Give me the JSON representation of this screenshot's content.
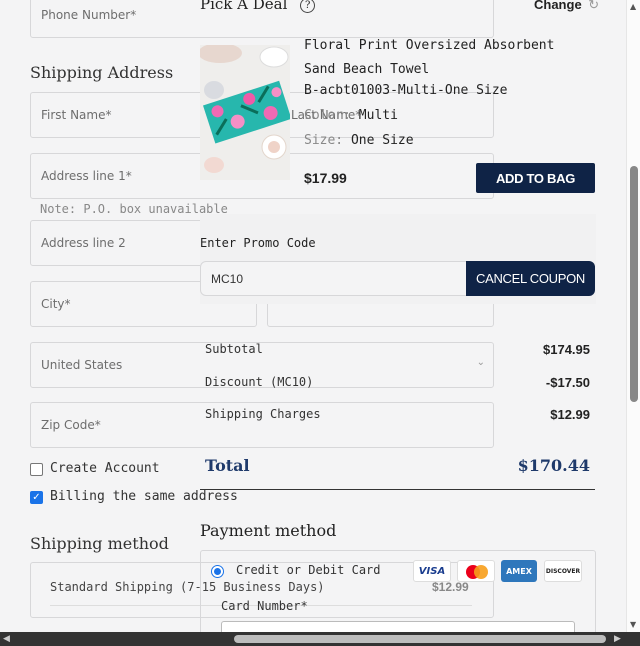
{
  "left_form": {
    "phone_placeholder": "Phone Number*",
    "shipping_address_heading": "Shipping Address",
    "first_name_placeholder": "First Name*",
    "last_name_placeholder": "Last Name*",
    "address1_placeholder": "Address line 1*",
    "po_box_note": "Note: P.O. box unavailable",
    "address2_placeholder": "Address line 2",
    "city_placeholder": "City*",
    "country_value": "United States",
    "zip_placeholder": "Zip Code*",
    "create_account_label": "Create Account",
    "billing_same_label": "Billing the same address",
    "shipping_method_heading": "Shipping method",
    "standard_shipping_label": "Standard Shipping (7-15 Business Days)",
    "standard_shipping_price": "$12.99"
  },
  "deal": {
    "title": "Pick A Deal",
    "change_label": "Change",
    "product_name": "Floral Print Oversized Absorbent Sand Beach Towel",
    "sku": "B-acbt01003-Multi-One Size",
    "color_label": "Color:",
    "color_value": "Multi",
    "size_label": "Size:",
    "size_value": "One Size",
    "price": "$17.99",
    "add_to_bag_label": "ADD TO BAG"
  },
  "promo": {
    "label": "Enter Promo Code",
    "code_value": "MC10",
    "cancel_label": "CANCEL COUPON"
  },
  "summary": {
    "subtotal_label": "Subtotal",
    "subtotal_value": "$174.95",
    "discount_label": "Discount (MC10)",
    "discount_value": "-$17.50",
    "shipping_label": "Shipping Charges",
    "shipping_value": "$12.99",
    "total_label": "Total",
    "total_value": "$170.44"
  },
  "payment": {
    "heading": "Payment method",
    "credit_label": "Credit or Debit Card",
    "card_number_label": "Card Number*",
    "cards": [
      "VISA",
      "AMEX",
      "DISCOVER"
    ]
  },
  "colors": {
    "navy": "#0f2346",
    "total_blue": "#1f3a6b"
  }
}
